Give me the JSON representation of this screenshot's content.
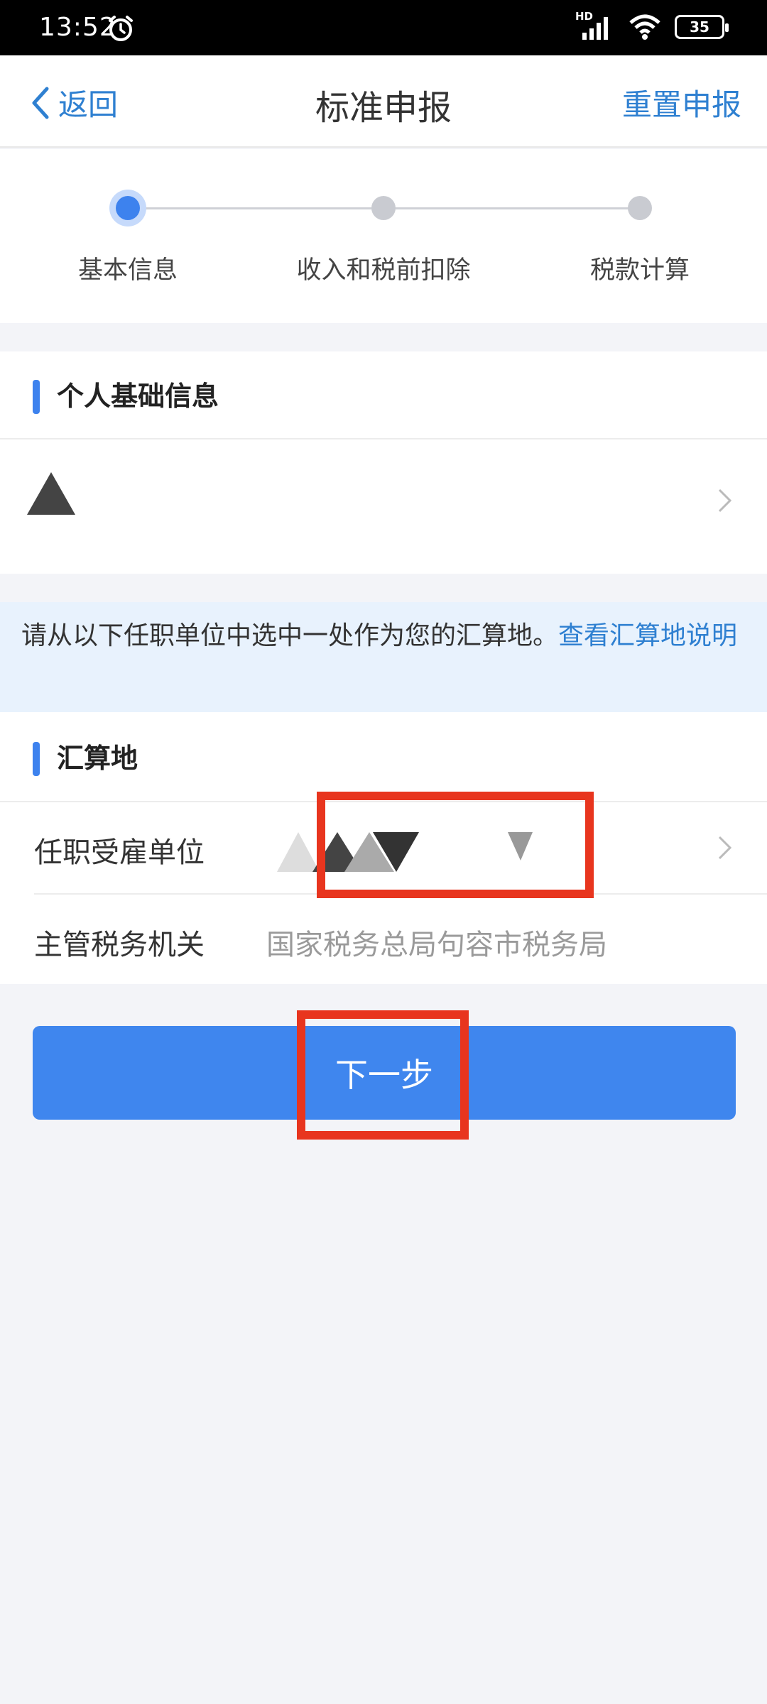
{
  "status_bar": {
    "time": "13:52",
    "battery": "35",
    "network": "HD"
  },
  "header": {
    "back_label": "返回",
    "title": "标准申报",
    "reset_label": "重置申报"
  },
  "steps": [
    {
      "label": "基本信息",
      "active": true
    },
    {
      "label": "收入和税前扣除",
      "active": false
    },
    {
      "label": "税款计算",
      "active": false
    }
  ],
  "personal_section": {
    "title": "个人基础信息"
  },
  "notice": {
    "text": "请从以下任职单位中选中一处作为您的汇算地。",
    "link": "查看汇算地说明"
  },
  "settlement_section": {
    "title": "汇算地",
    "employer_label": "任职受雇单位",
    "tax_office_label": "主管税务机关",
    "tax_office_value": "国家税务总局句容市税务局"
  },
  "next_button": "下一步",
  "colors": {
    "accent": "#3f86ee",
    "link": "#2f80d1",
    "highlight_box": "#e8351e"
  }
}
